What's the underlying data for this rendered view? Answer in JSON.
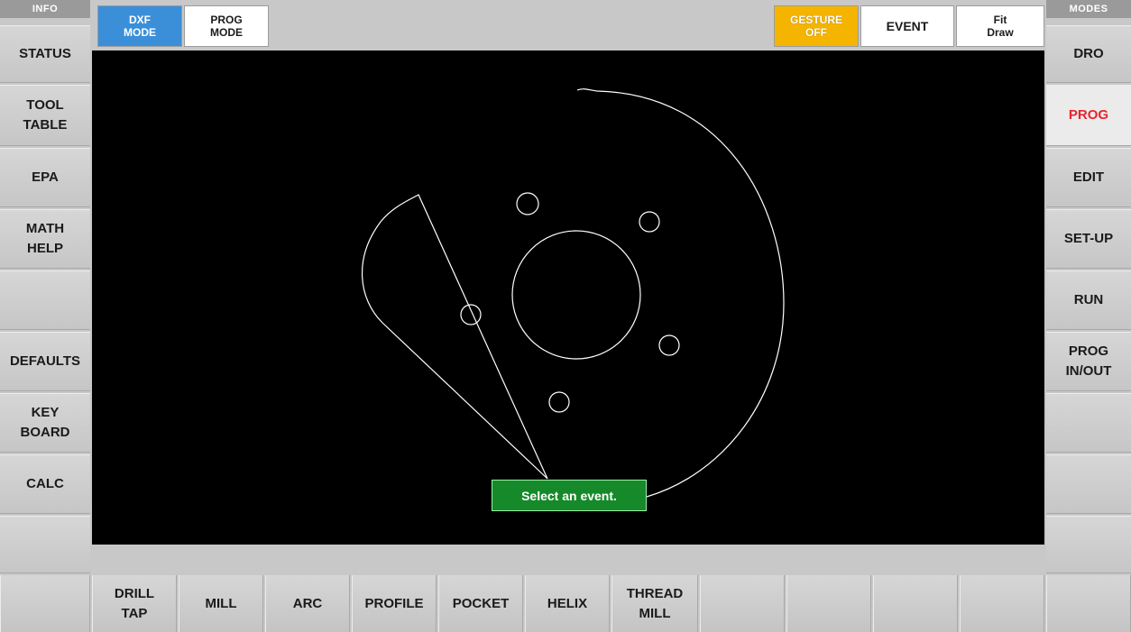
{
  "left_panel": {
    "header": "INFO",
    "items": [
      {
        "label": "STATUS"
      },
      {
        "label": "TOOL\nTABLE"
      },
      {
        "label": "EPA"
      },
      {
        "label": "MATH\nHELP"
      },
      {
        "label": ""
      },
      {
        "label": "DEFAULTS"
      },
      {
        "label": "KEY\nBOARD"
      },
      {
        "label": "CALC"
      },
      {
        "label": ""
      }
    ]
  },
  "right_panel": {
    "header": "MODES",
    "items": [
      {
        "label": "DRO"
      },
      {
        "label": "PROG",
        "active": true
      },
      {
        "label": "EDIT"
      },
      {
        "label": "SET-UP"
      },
      {
        "label": "RUN"
      },
      {
        "label": "PROG\nIN/OUT"
      },
      {
        "label": ""
      },
      {
        "label": ""
      },
      {
        "label": ""
      }
    ]
  },
  "top_bar": {
    "dxf_mode": "DXF\nMODE",
    "prog_mode": "PROG\nMODE",
    "gesture": "GESTURE\nOFF",
    "event": "EVENT",
    "fit_draw": "Fit\nDraw"
  },
  "canvas": {
    "status_message": "Select an event."
  },
  "bottom_bar": {
    "items": [
      {
        "label": ""
      },
      {
        "label": "DRILL\nTAP"
      },
      {
        "label": "MILL"
      },
      {
        "label": "ARC"
      },
      {
        "label": "PROFILE"
      },
      {
        "label": "POCKET"
      },
      {
        "label": "HELIX"
      },
      {
        "label": "THREAD\nMILL"
      },
      {
        "label": ""
      },
      {
        "label": ""
      },
      {
        "label": ""
      },
      {
        "label": ""
      },
      {
        "label": ""
      }
    ]
  },
  "colors": {
    "active_mode_text": "#e8242c",
    "dxf_mode_bg": "#3b8fd9",
    "gesture_bg": "#f4b400",
    "status_bg": "#168a2a",
    "canvas_bg": "#000000"
  }
}
